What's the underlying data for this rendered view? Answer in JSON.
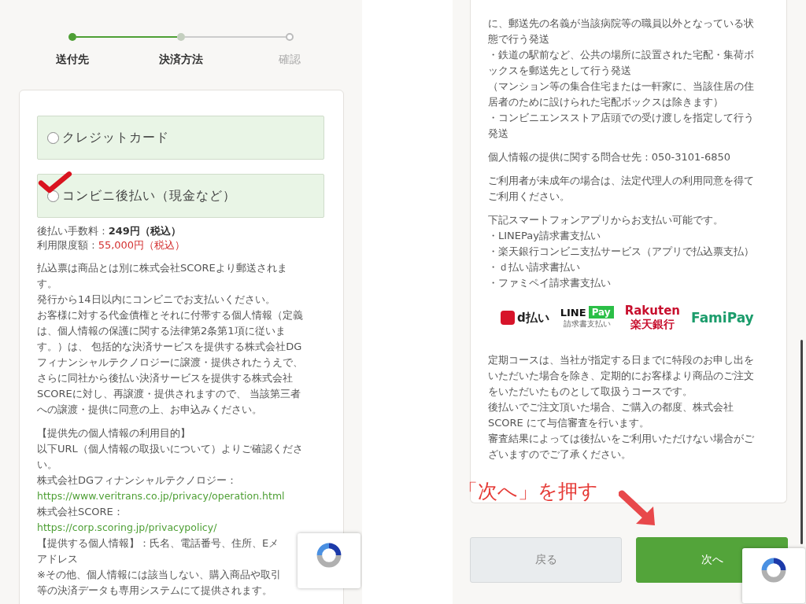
{
  "left_screen": {
    "steps": [
      {
        "label": "送付先",
        "completed": true,
        "selected": false
      },
      {
        "label": "決済方法",
        "completed": false,
        "selected": true
      },
      {
        "label": "確認",
        "completed": false,
        "selected": false
      }
    ],
    "payment_options": [
      {
        "label": "クレジットカード",
        "selected": false
      },
      {
        "label": "コンビニ後払い（現金など）",
        "selected": false
      }
    ],
    "fee_lines": [
      {
        "label": "後払い手数料 : ",
        "value": "249円（税込）",
        "kind": "bold"
      },
      {
        "label": "利用限度額 : ",
        "value": "55,000円（税込）",
        "kind": "alert"
      }
    ],
    "blocks": [
      {
        "lines": [
          {
            "text": "払込票は商品とは別に株式会社SCOREより郵送されます。",
            "kind": "text"
          },
          {
            "text": "発行から14日以内にコンビニでお支払いください。",
            "kind": "text"
          },
          {
            "text": "お客様に対する代金債権とそれに付帯する個人情報（定義は、個人情報の保護に関する法律第2条第1項に従います。）は、 包括的な決済サービスを提供する株式会社DGフィナンシャルテクノロジーに譲渡・提供されたうえで、さらに同社から後払い決済サービスを提供する株式会社SCOREに対し、再譲渡・提供されますので、 当該第三者への譲渡・提供に同意の上、お申込みください。",
            "kind": "text"
          }
        ]
      },
      {
        "lines": [
          {
            "text": "【提供先の個人情報の利用目的】",
            "kind": "text"
          },
          {
            "text": "以下URL（個人情報の取扱いについて）よりご確認ください。",
            "kind": "text"
          },
          {
            "text": "株式会社DGフィナンシャルテクノロジー：",
            "kind": "text"
          },
          {
            "text": "https://www.veritrans.co.jp/privacy/operation.html",
            "kind": "link"
          },
          {
            "text": "株式会社SCORE：",
            "kind": "text"
          },
          {
            "text": "https://corp.scoring.jp/privacypolicy/",
            "kind": "link"
          },
          {
            "text": "【提供する個人情報】：氏名、電話番号、住所、Eメ",
            "kind": "line"
          },
          {
            "text": "アドレス",
            "kind": "line"
          },
          {
            "text": "※その他、個人情報には該当しない、購入商品や取引",
            "kind": "line"
          },
          {
            "text": "等の決済データも専用システムにて提供されます。",
            "kind": "line"
          }
        ]
      }
    ]
  },
  "right_screen": {
    "blocks_top": [
      {
        "lines": [
          {
            "text": "に、郵送先の名義が当該病院等の職員以外となっている状態で行う発送"
          },
          {
            "text": "・鉄道の駅前など、公共の場所に設置された宅配・集荷ボックスを郵送先として行う発送"
          },
          {
            "text": "（マンション等の集合住宅または一軒家に、当該住居の住居者のために設けられた宅配ボックスは除きます）"
          },
          {
            "text": "・コンビニエンスストア店頭での受け渡しを指定して行う発送"
          }
        ]
      },
      {
        "lines": [
          {
            "text": "個人情報の提供に関する問合せ先 : 050-3101-6850"
          }
        ]
      },
      {
        "lines": [
          {
            "text": "ご利用者が未成年の場合は、法定代理人の利用同意を得てご利用ください。"
          }
        ]
      },
      {
        "lines": [
          {
            "text": "下記スマートフォンアプリからお支払い可能です。"
          },
          {
            "text": "・LINEPay請求書支払い"
          },
          {
            "text": "・楽天銀行コンビニ支払サービス（アプリで払込票支払）"
          },
          {
            "text": "・ｄ払い請求書払い"
          },
          {
            "text": "・ファミペイ請求書支払い"
          }
        ]
      }
    ],
    "payment_logos": [
      {
        "kind": "dpay",
        "texts": [
          "d払い"
        ]
      },
      {
        "kind": "linepay",
        "texts": [
          "LINE",
          "Pay",
          "請求書支払い"
        ]
      },
      {
        "kind": "rakuten",
        "texts": [
          "Rakuten",
          "楽天銀行"
        ]
      },
      {
        "kind": "famipay",
        "texts": [
          "FamiPay"
        ]
      }
    ],
    "blocks_bottom": [
      {
        "lines": [
          {
            "text": "定期コースは、当社が指定する日までに特段のお申し出をいただいた場合を除き、定期的にお客様より商品のご注文をいただいたものとして取扱うコースです。"
          },
          {
            "text": "後払いでご注文頂いた場合、ご購入の都度、株式会社SCORE にて与信審査を行います。"
          },
          {
            "text": "審査結果によっては後払いをご利用いただけない場合がございますのでご了承ください。"
          }
        ]
      }
    ],
    "buttons": [
      {
        "label": "戻る",
        "kind": "secondary"
      },
      {
        "label": "次へ",
        "kind": "primary"
      }
    ],
    "callout": "「次へ」を押す"
  }
}
